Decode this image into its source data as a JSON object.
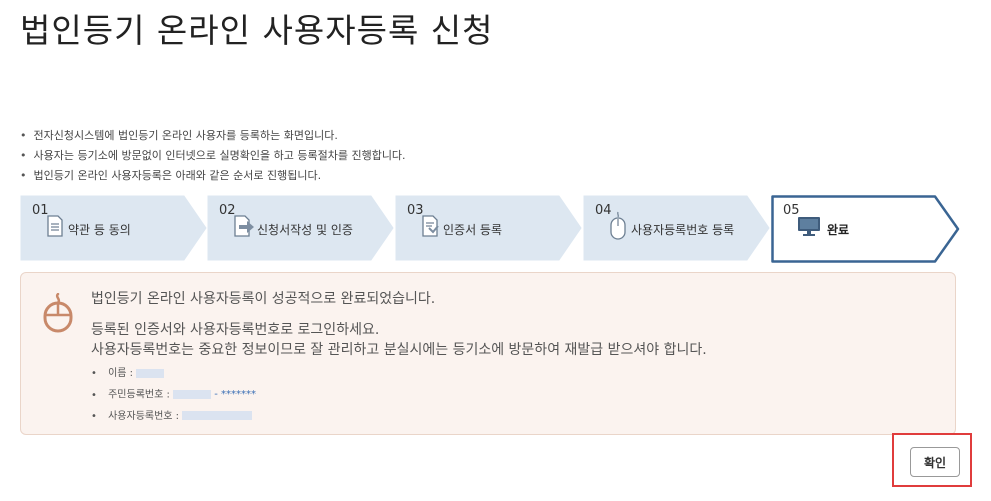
{
  "page": {
    "title": "법인등기 온라인 사용자등록 신청"
  },
  "intro": [
    "전자신청시스템에 법인등기 온라인 사용자를 등록하는 화면입니다.",
    "사용자는 등기소에 방문없이 인터넷으로 실명확인을 하고 등록절차를 진행합니다.",
    "법인등기 온라인 사용자등록은 아래와 같은 순서로 진행됩니다."
  ],
  "steps": [
    {
      "num": "01",
      "label": "약관 등 동의",
      "icon": "document-icon"
    },
    {
      "num": "02",
      "label": "신청서작성 및 인증",
      "icon": "form-arrow-icon"
    },
    {
      "num": "03",
      "label": "인증서 등록",
      "icon": "certificate-icon"
    },
    {
      "num": "04",
      "label": "사용자등록번호 등록",
      "icon": "mouse-icon"
    },
    {
      "num": "05",
      "label": "완료",
      "icon": "monitor-icon",
      "active": true
    }
  ],
  "result": {
    "icon": "mouse-icon",
    "message": "법인등기 온라인 사용자등록이 성공적으로 완료되었습니다.",
    "sub_line1": "등록된 인증서와 사용자등록번호로 로그인하세요.",
    "sub_line2": "사용자등록번호는 중요한 정보이므로 잘 관리하고 분실시에는 등기소에 방문하여 재발급 받으셔야 합니다.",
    "fields": {
      "name_label": "이름 :",
      "rrn_label": "주민등록번호 :",
      "rrn_suffix": "- *******",
      "user_no_label": "사용자등록번호 :"
    }
  },
  "actions": {
    "confirm_label": "확인"
  },
  "colors": {
    "step_fill": "#dde7f1",
    "step_active_border": "#3a6593",
    "panel_bg": "#fbf3ef",
    "mouse_icon": "#c8896a",
    "highlight": "#e03c3c"
  }
}
